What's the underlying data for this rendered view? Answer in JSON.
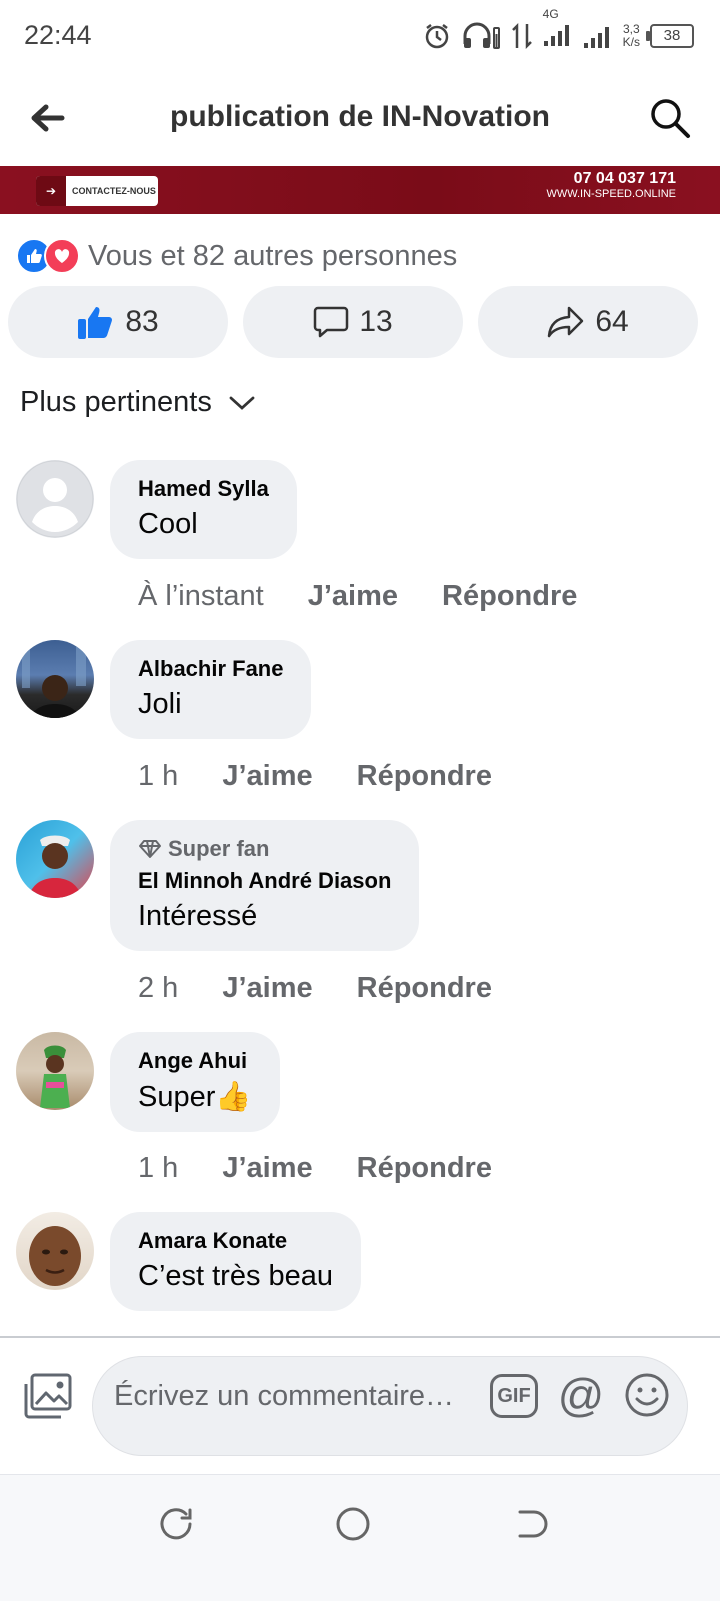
{
  "status_bar": {
    "time": "22:44",
    "network": "4G",
    "speed_value": "3,3",
    "speed_unit": "K/s",
    "battery": "38"
  },
  "header": {
    "title": "publication de IN-Novation"
  },
  "banner": {
    "contact_label": "CONTACTEZ-NOUS",
    "phone": "07 04 037 171",
    "website": "WWW.IN-SPEED.ONLINE"
  },
  "reactions": {
    "summary": "Vous et 82 autres personnes",
    "likes": "83",
    "comments": "13",
    "shares": "64"
  },
  "sort": {
    "label": "Plus pertinents"
  },
  "comments": [
    {
      "name": "Hamed Sylla",
      "text": "Cool",
      "time": "À l’instant",
      "like": "J’aime",
      "reply": "Répondre"
    },
    {
      "name": "Albachir Fane",
      "text": "Joli",
      "time": "1 h",
      "like": "J’aime",
      "reply": "Répondre"
    },
    {
      "badge": "Super fan",
      "name": "El Minnoh André Diason",
      "text": "Intéressé",
      "time": "2 h",
      "like": "J’aime",
      "reply": "Répondre"
    },
    {
      "name": "Ange Ahui",
      "text": "Super👍",
      "time": "1 h",
      "like": "J’aime",
      "reply": "Répondre"
    },
    {
      "name": "Amara Konate",
      "text": "C’est très beau"
    }
  ],
  "composer": {
    "placeholder": "Écrivez un commentaire…",
    "gif_label": "GIF",
    "mention": "@"
  },
  "colors": {
    "accent": "#1877f2",
    "love": "#f33e58",
    "bubble": "#eef0f3",
    "banner": "#7a0c18"
  }
}
